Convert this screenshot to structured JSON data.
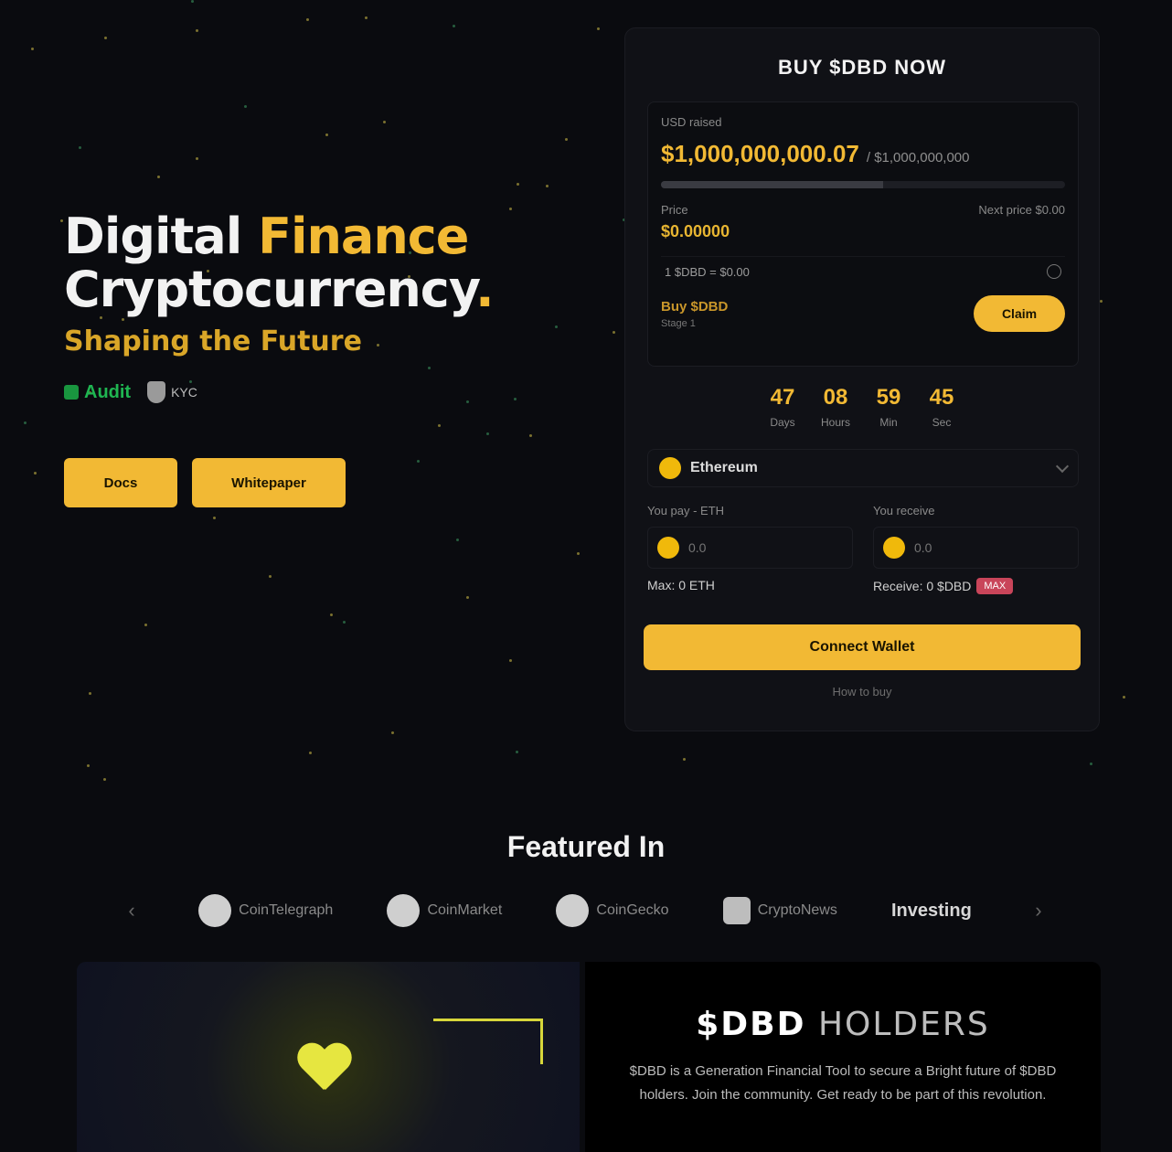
{
  "colors": {
    "accent": "#f2b934",
    "background": "#0a0b0f",
    "audit_green": "#1fb551",
    "max_tag": "#c9455a"
  },
  "hero": {
    "title_white_1": "Digital",
    "title_yellow_1": "Finance",
    "title_white_2": "Cryptocurrency",
    "title_yellow_2": ".",
    "subtitle": "Shaping the Future",
    "audit_badge": "Audit",
    "kyc_badge": "KYC",
    "docs_label": "Docs",
    "whitepaper_label": "Whitepaper"
  },
  "presale": {
    "title": "BUY $DBD NOW",
    "raised_label": "USD raised",
    "raised_value": "$1,000,000,000.07",
    "raised_total": "/ $1,000,000,000",
    "progress_fraction": 0.55,
    "price_label": "Price",
    "price_value": "$0.00000",
    "next_price": "Next price $0.00",
    "rate_text": "1 $DBD = $0.00",
    "stage_label": "Buy $DBD",
    "stage_small": "Stage 1",
    "claim_label": "Claim",
    "countdown": [
      {
        "value": "47",
        "label": "Days"
      },
      {
        "value": "08",
        "label": "Hours"
      },
      {
        "value": "59",
        "label": "Min"
      },
      {
        "value": "45",
        "label": "Sec"
      }
    ],
    "network_label": "Ethereum",
    "pay_label": "You pay - ETH",
    "receive_label": "You receive",
    "pay_placeholder": "0.0",
    "receive_placeholder": "0.0",
    "pay_note": "Max: 0 ETH",
    "receive_note": "Receive: 0 $DBD",
    "max_tag": "MAX",
    "connect_label": "Connect Wallet",
    "help_link": "How to buy"
  },
  "featured": {
    "title": "Featured In",
    "logos": [
      {
        "icon": "coin-logo",
        "name": "CoinTelegraph"
      },
      {
        "icon": "coin-logo",
        "name": "CoinMarket"
      },
      {
        "icon": "coin-logo",
        "name": "CoinGecko"
      },
      {
        "icon": "square-logo",
        "name": "CryptoNews"
      },
      {
        "icon": "text-logo",
        "name": "Investing"
      }
    ]
  },
  "holders": {
    "title_bold": "$DBD",
    "title_thin": "HOLDERS",
    "description": "$DBD is a Generation Financial Tool to secure a Bright future of $DBD holders. Join the community. Get ready to be part of this revolution."
  }
}
